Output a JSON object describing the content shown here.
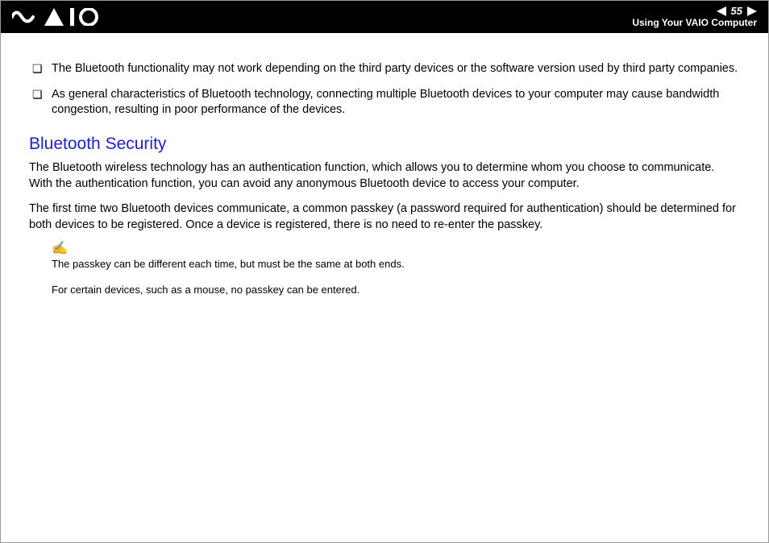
{
  "header": {
    "page_number": "55",
    "section": "Using Your VAIO Computer"
  },
  "bullets": [
    "The Bluetooth functionality may not work depending on the third party devices or the software version used by third party companies.",
    "As general characteristics of Bluetooth technology, connecting multiple Bluetooth devices to your computer may cause bandwidth congestion, resulting in poor performance of the devices."
  ],
  "heading": "Bluetooth Security",
  "paragraphs": [
    "The Bluetooth wireless technology has an authentication function, which allows you to determine whom you choose to communicate. With the authentication function, you can avoid any anonymous Bluetooth device to access your computer.",
    "The first time two Bluetooth devices communicate, a common passkey (a password required for authentication) should be determined for both devices to be registered. Once a device is registered, there is no need to re-enter the passkey."
  ],
  "note": {
    "icon": "✍",
    "lines": [
      "The passkey can be different each time, but must be the same at both ends.",
      "For certain devices, such as a mouse, no passkey can be entered."
    ]
  }
}
